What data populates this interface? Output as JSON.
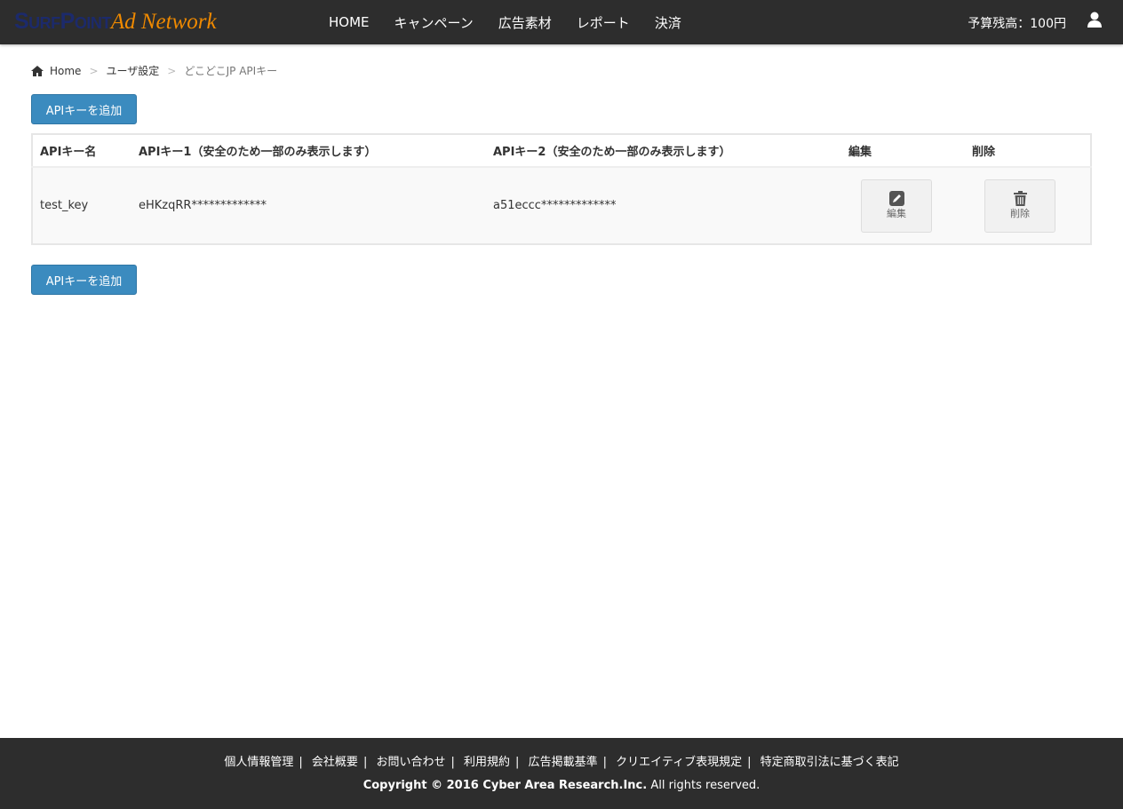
{
  "logo": {
    "part1": "SurfPoint",
    "part2": "Ad Network"
  },
  "nav": {
    "items": [
      "HOME",
      "キャンペーン",
      "広告素材",
      "レポート",
      "決済"
    ],
    "budget": "予算残高：100円"
  },
  "breadcrumb": {
    "home": "Home",
    "parent": "ユーザ設定",
    "current": "どこどこJP APIキー"
  },
  "add_button": "APIキーを追加",
  "table": {
    "headers": [
      "APIキー名",
      "APIキー1（安全のため一部のみ表示します）",
      "APIキー2（安全のため一部のみ表示します）",
      "編集",
      "削除"
    ],
    "rows": [
      {
        "name": "test_key",
        "key1": "eHKzqRR*************",
        "key2": "a51eccc*************",
        "edit": "編集",
        "delete": "削除"
      }
    ]
  },
  "footer": {
    "links": [
      "個人情報管理",
      "会社概要",
      "お問い合わせ",
      "利用規約",
      "広告掲載基準",
      "クリエイティブ表現規定",
      "特定商取引法に基づく表記"
    ],
    "copyright_bold": "Copyright © 2016 Cyber Area Research.Inc.",
    "copyright_rest": " All rights reserved."
  }
}
